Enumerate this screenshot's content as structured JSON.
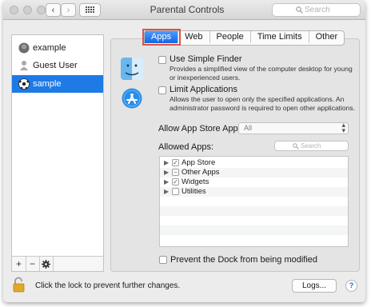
{
  "window": {
    "title": "Parental Controls",
    "search_placeholder": "Search"
  },
  "users": [
    {
      "name": "example",
      "icon": "avatar-icon"
    },
    {
      "name": "Guest User",
      "icon": "person-icon"
    },
    {
      "name": "sample",
      "icon": "soccer-ball-icon",
      "selected": true
    }
  ],
  "list_footer": {
    "add": "+",
    "remove": "−",
    "settings": "gear-icon"
  },
  "tabs": [
    "Apps",
    "Web",
    "People",
    "Time Limits",
    "Other"
  ],
  "active_tab": "Apps",
  "options": {
    "simple_finder": {
      "title": "Use Simple Finder",
      "desc1": "Provides a simplified view of the computer desktop for young",
      "desc2": "or inexperienced users."
    },
    "limit_apps": {
      "title": "Limit Applications",
      "desc1": "Allows the user to open only the specified applications. An",
      "desc2": "administrator password is required to open other applications."
    }
  },
  "app_store": {
    "label": "Allow App Store Apps:",
    "value": "All"
  },
  "allowed_apps": {
    "label": "Allowed Apps:",
    "search_placeholder": "Search",
    "items": [
      {
        "label": "App Store",
        "state": "✓"
      },
      {
        "label": "Other Apps",
        "state": "−"
      },
      {
        "label": "Widgets",
        "state": "✓"
      },
      {
        "label": "Utilities",
        "state": ""
      }
    ]
  },
  "dock": {
    "label": "Prevent the Dock from being modified"
  },
  "footer": {
    "lock_text": "Click the lock to prevent further changes.",
    "logs": "Logs...",
    "help": "?"
  },
  "colors": {
    "accent": "#1e7ae5",
    "highlight": "#d9534f"
  }
}
